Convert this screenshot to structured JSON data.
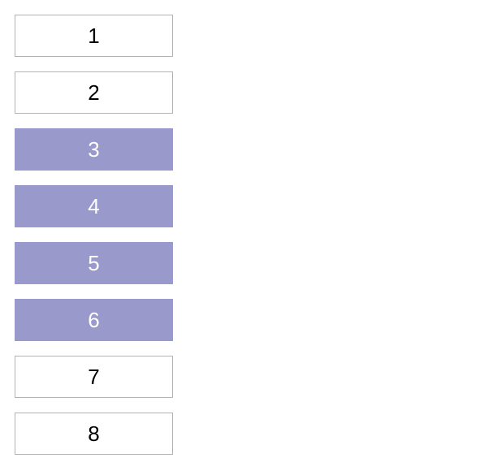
{
  "list": {
    "items": [
      {
        "label": "1",
        "selected": false
      },
      {
        "label": "2",
        "selected": false
      },
      {
        "label": "3",
        "selected": true
      },
      {
        "label": "4",
        "selected": true
      },
      {
        "label": "5",
        "selected": true
      },
      {
        "label": "6",
        "selected": true
      },
      {
        "label": "7",
        "selected": false
      },
      {
        "label": "8",
        "selected": false
      }
    ]
  }
}
